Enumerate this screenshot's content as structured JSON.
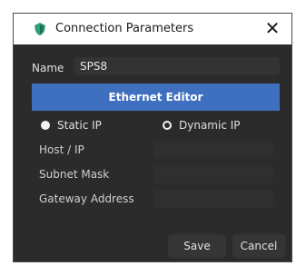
{
  "window": {
    "title": "Connection Parameters",
    "close_symbol": "✕",
    "icon": "app-shield-icon",
    "accent_color": "#3f6fbf"
  },
  "name_field": {
    "label": "Name",
    "value": "SPS8"
  },
  "ethernet_button": {
    "label": "Ethernet Editor"
  },
  "ip_mode": {
    "options": [
      {
        "label": "Static IP",
        "selected": true
      },
      {
        "label": "Dynamic IP",
        "selected": false
      }
    ]
  },
  "fields": [
    {
      "label": "Host / IP",
      "value": ""
    },
    {
      "label": "Subnet Mask",
      "value": ""
    },
    {
      "label": "Gateway Address",
      "value": ""
    }
  ],
  "buttons": {
    "save": "Save",
    "cancel": "Cancel"
  }
}
